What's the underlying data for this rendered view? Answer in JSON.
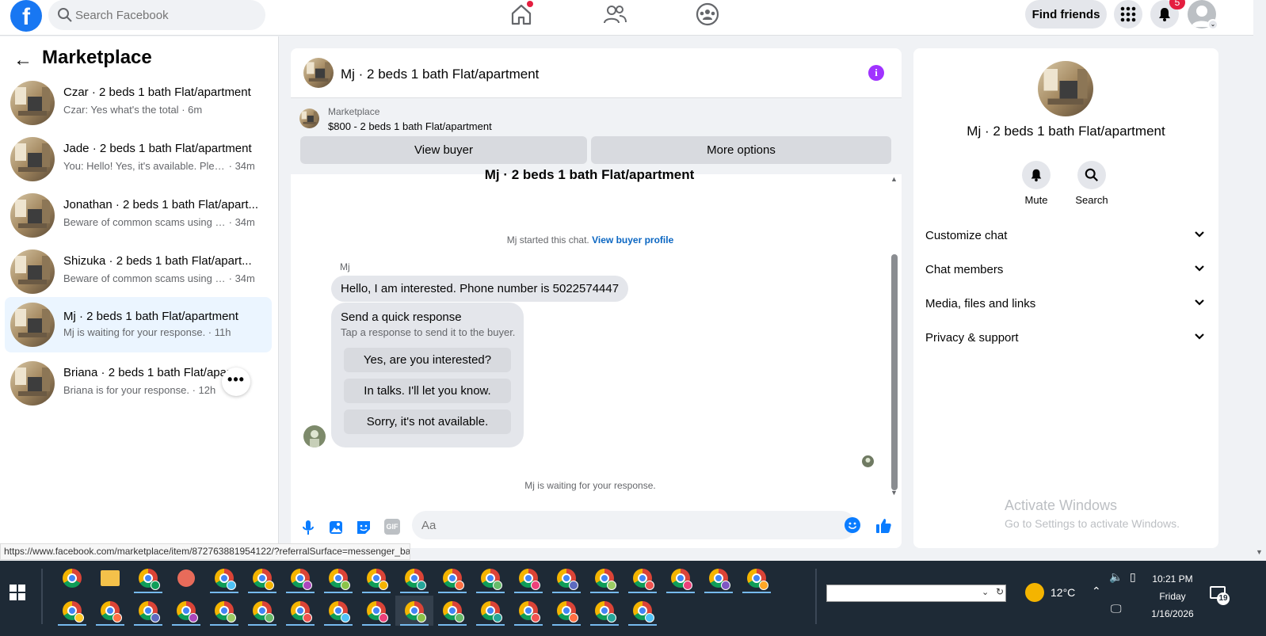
{
  "topbar": {
    "logo": "f",
    "search_placeholder": "Search Facebook",
    "find_friends": "Find friends",
    "notification_count": "5",
    "nav_icons": [
      "home-icon",
      "friends-icon",
      "groups-icon"
    ]
  },
  "sidebar": {
    "title": "Marketplace",
    "conversations": [
      {
        "name": "Czar · 2 beds 1 bath Flat/apartment",
        "preview": "Czar: Yes what's the total",
        "time": "6m"
      },
      {
        "name": "Jade · 2 beds 1 bath Flat/apartment",
        "preview": "You: Hello! Yes, it's available. Please ...",
        "time": "34m"
      },
      {
        "name": "Jonathan · 2 beds 1 bath Flat/apart...",
        "preview": "Beware of common scams using pa...",
        "time": "34m"
      },
      {
        "name": "Shizuka · 2 beds 1 bath Flat/apart...",
        "preview": "Beware of common scams using pa...",
        "time": "34m"
      },
      {
        "name": "Mj · 2 beds 1 bath Flat/apartment",
        "preview": "Mj is waiting for your response.",
        "time": "11h"
      },
      {
        "name": "Briana · 2 beds 1 bath Flat/apar...",
        "preview": "Briana is for your response.",
        "time": "12h"
      }
    ],
    "more": "•••"
  },
  "chat": {
    "title": "Mj · 2 beds 1 bath Flat/apartment",
    "marketplace_label": "Marketplace",
    "listing": "$800 - 2 beds 1 bath Flat/apartment",
    "view_buyer": "View buyer",
    "more_options": "More options",
    "cut_title": "Mj · 2 beds 1 bath Flat/apartment",
    "started_text": "Mj started this chat.",
    "view_buyer_profile": "View buyer profile",
    "sender": "Mj",
    "message": "Hello, I am interested. Phone number is 5022574447",
    "quick_response_title": "Send a quick response",
    "quick_response_sub": "Tap a response to send it to the buyer.",
    "quick_responses": [
      "Yes, are you interested?",
      "In talks. I'll let you know.",
      "Sorry, it's not available."
    ],
    "waiting": "Mj is waiting for your response.",
    "composer_placeholder": "Aa",
    "gif": "GIF"
  },
  "right_panel": {
    "title": "Mj · 2 beds 1 bath Flat/apartment",
    "mute": "Mute",
    "search": "Search",
    "sections": [
      "Customize chat",
      "Chat members",
      "Media, files and links",
      "Privacy & support"
    ]
  },
  "watermark": {
    "line1": "Activate Windows",
    "line2": "Go to Settings to activate Windows."
  },
  "status_url": "https://www.facebook.com/marketplace/item/872763881954122/?referralSurface=messenger_ba...",
  "taskbar": {
    "temperature": "12°C",
    "time": "10:21 PM",
    "day": "Friday",
    "date": "1/16/2026",
    "notif_count": "19"
  },
  "colors": {
    "accent": "#1877f2",
    "link": "#0a66c2",
    "info": "#a033ff",
    "badge": "#e41e3f"
  }
}
